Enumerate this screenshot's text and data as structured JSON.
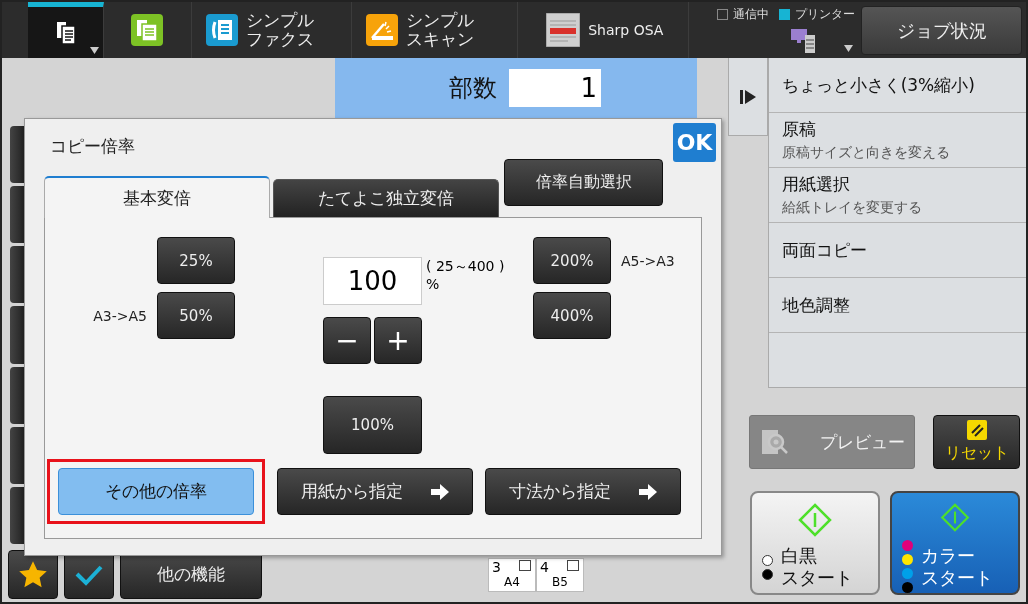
{
  "top_bar": {
    "modes": [
      {
        "kind": "copy",
        "selected": true
      },
      {
        "kind": "copy-app",
        "selected": false
      },
      {
        "kind": "fax",
        "lines": [
          "シンプル",
          "ファクス"
        ],
        "selected": false
      },
      {
        "kind": "scan",
        "lines": [
          "シンプル",
          "スキャン"
        ],
        "selected": false
      },
      {
        "kind": "osa",
        "lines": [
          "Sharp OSA"
        ],
        "selected": false
      }
    ],
    "status": [
      {
        "label": "通信中",
        "on": false
      },
      {
        "label": "プリンター",
        "on": true
      }
    ],
    "job_status_button": "ジョブ状況"
  },
  "copies": {
    "label": "部数",
    "value": "1"
  },
  "dialog": {
    "title": "コピー倍率",
    "ok": "OK",
    "tabs": [
      {
        "label": "基本変倍",
        "selected": true
      },
      {
        "label": "たてよこ独立変倍",
        "selected": false
      }
    ],
    "auto_button": "倍率自動選択",
    "left_presets": [
      {
        "value": "25%"
      },
      {
        "value": "50%",
        "note": "A3->A5"
      }
    ],
    "right_presets": [
      {
        "value": "200%",
        "note": "A5->A3"
      },
      {
        "value": "400%"
      }
    ],
    "zoom_field": {
      "value": "100",
      "range": "( 25～400 )",
      "unit": "%"
    },
    "steppers": [
      "−",
      "+"
    ],
    "reset_preset": "100%",
    "bottom_buttons": [
      {
        "label": "その他の倍率",
        "kind": "plain",
        "selected": true,
        "highlighted": true
      },
      {
        "label": "用紙から指定",
        "kind": "arrow",
        "selected": false,
        "highlighted": false
      },
      {
        "label": "寸法から指定",
        "kind": "arrow",
        "selected": false,
        "highlighted": false
      }
    ]
  },
  "bottom_bar": {
    "other_functions": "他の機能",
    "trays": [
      {
        "number": "3",
        "size": "A4"
      },
      {
        "number": "4",
        "size": "B5"
      }
    ]
  },
  "right_panel": {
    "menu": [
      {
        "title": "ちょっと小さく(3%縮小)"
      },
      {
        "title": "原稿",
        "subtitle": "原稿サイズと向きを変える"
      },
      {
        "title": "用紙選択",
        "subtitle": "給紙トレイを変更する"
      },
      {
        "title": "両面コピー"
      },
      {
        "title": "地色調整"
      }
    ],
    "preview": {
      "label": "プレビュー",
      "disabled": true
    },
    "reset": "リセット",
    "start_buttons": [
      {
        "kind": "mono",
        "lines": [
          "白黒",
          "スタート"
        ],
        "dots": [
          {
            "color": "#ffffff"
          },
          {
            "color": "#000000"
          }
        ]
      },
      {
        "kind": "color",
        "lines": [
          "カラー",
          "スタート"
        ],
        "dots": [
          {
            "color": "#e0007a"
          },
          {
            "color": "#ffe600"
          },
          {
            "color": "#00a0e9"
          },
          {
            "color": "#000000"
          }
        ]
      }
    ]
  }
}
